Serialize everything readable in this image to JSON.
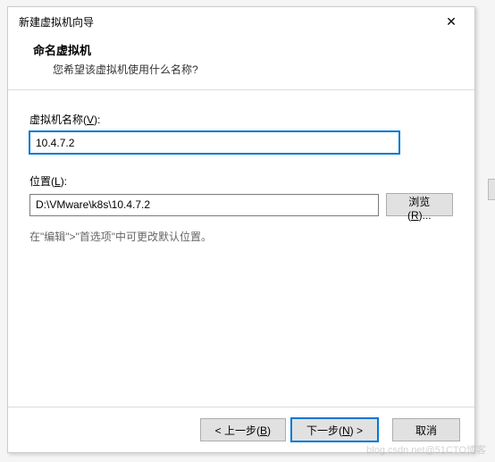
{
  "dialog": {
    "title": "新建虚拟机向导",
    "close_symbol": "✕"
  },
  "header": {
    "title": "命名虚拟机",
    "subtitle": "您希望该虚拟机使用什么名称?"
  },
  "fields": {
    "name_label_prefix": "虚拟机名称(",
    "name_label_key": "V",
    "name_label_suffix": "):",
    "name_value": "10.4.7.2",
    "location_label_prefix": "位置(",
    "location_label_key": "L",
    "location_label_suffix": "):",
    "location_value": "D:\\VMware\\k8s\\10.4.7.2",
    "browse_prefix": "浏览(",
    "browse_key": "R",
    "browse_suffix": ")..."
  },
  "hint": "在\"编辑\">\"首选项\"中可更改默认位置。",
  "buttons": {
    "back_prefix": "< 上一步(",
    "back_key": "B",
    "back_suffix": ")",
    "next_prefix": "下一步(",
    "next_key": "N",
    "next_suffix": ") >",
    "cancel": "取消"
  },
  "watermark": "blog.csdn.net@51CTO博客"
}
